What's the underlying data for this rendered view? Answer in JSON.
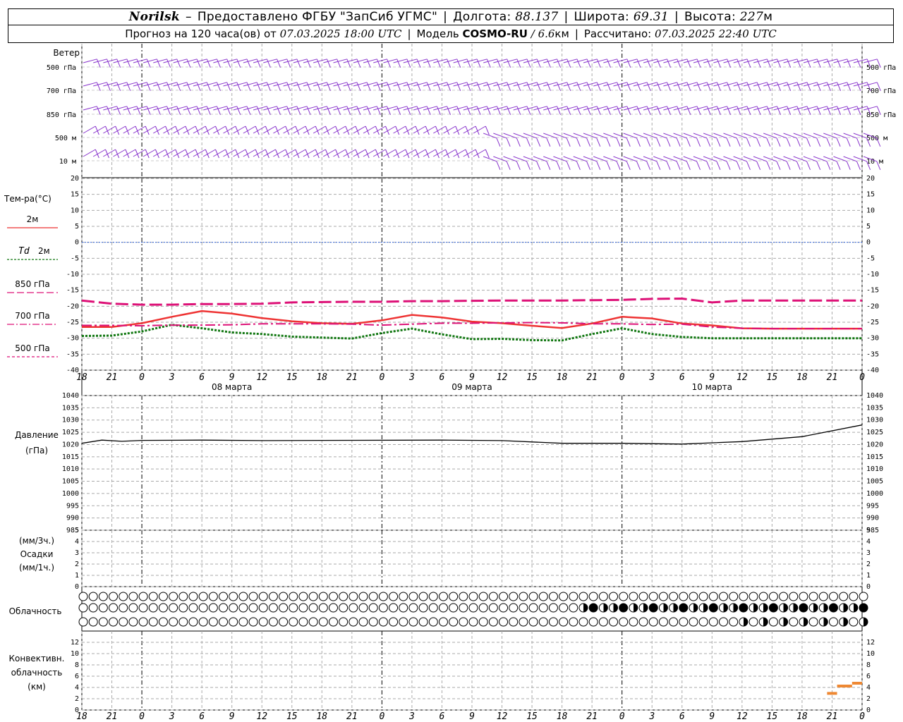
{
  "header": {
    "station": "Norilsk",
    "dash": "–",
    "provider": "Предоставлено ФГБУ \"ЗапСиб УГМС\"",
    "lon_label": "Долгота:",
    "lon_value": "88.137",
    "lat_label": "Широта:",
    "lat_value": "69.31",
    "alt_label": "Высота:",
    "alt_value": "227",
    "alt_unit": "м",
    "forecast_label": "Прогноз на 120 часа(ов) от",
    "forecast_time": "07.03.2025 18:00 UTC",
    "model_label": "Модель",
    "model_name": "COSMO-RU",
    "model_res_sep": "/",
    "model_res": "6.6",
    "model_res_unit": "км",
    "calc_label": "Рассчитано:",
    "calc_time": "07.03.2025 22:40 UTC"
  },
  "colors": {
    "t2m": "#ee3333",
    "td2m": "#117711",
    "t850": "#dd1177",
    "t700": "#dd1177",
    "t500": "#dd1177",
    "wind": "#8833cc",
    "zero": "#3366dd",
    "conv": "#ee8833",
    "pressure": "#000000"
  },
  "chart_data": [
    {
      "type": "wind_barbs",
      "label": "Ветер",
      "levels": [
        "500 гПа",
        "700 гПа",
        "850 гПа",
        "500 м",
        "10 м"
      ]
    },
    {
      "type": "line",
      "label": "Тем-ра(°C)",
      "ylim": [
        -40,
        20
      ],
      "yticks": [
        20,
        15,
        10,
        5,
        0,
        -5,
        -10,
        -15,
        -20,
        -25,
        -30,
        -35,
        -40
      ],
      "x_hours": [
        0,
        3,
        6,
        9,
        12,
        15,
        18,
        21,
        24,
        27,
        30,
        33,
        36,
        39,
        42,
        45,
        48,
        51,
        54,
        57,
        60,
        63,
        66,
        69,
        72,
        75,
        78
      ],
      "series": [
        {
          "name": "2м",
          "style": "solid",
          "values": [
            -26.5,
            -26.5,
            -25.3,
            -23.3,
            -21.5,
            -22.3,
            -23.7,
            -24.7,
            -25.3,
            -25.5,
            -24.4,
            -22.7,
            -23.5,
            -24.8,
            -25.3,
            -26.1,
            -26.8,
            -25.4,
            -23.3,
            -23.8,
            -25.4,
            -26.0,
            -26.9,
            -27.0,
            -27.0,
            -27.0,
            -27.0
          ]
        },
        {
          "name": "Td 2м",
          "name_prefix": "Td",
          "name_suffix": "2м",
          "style": "dotted",
          "values": [
            -29.3,
            -29.2,
            -27.9,
            -25.8,
            -26.9,
            -28.2,
            -28.7,
            -29.5,
            -29.8,
            -30.1,
            -28.4,
            -27.0,
            -28.8,
            -30.3,
            -30.2,
            -30.6,
            -30.7,
            -28.7,
            -26.9,
            -28.7,
            -29.6,
            -30.0,
            -30.0,
            -30.0,
            -30.0,
            -30.0,
            -30.0
          ]
        },
        {
          "name": "850 гПа",
          "style": "longdash",
          "values": [
            -18.2,
            -19.2,
            -19.5,
            -19.5,
            -19.3,
            -19.3,
            -19.2,
            -18.8,
            -18.7,
            -18.6,
            -18.6,
            -18.4,
            -18.4,
            -18.3,
            -18.2,
            -18.2,
            -18.2,
            -18.1,
            -18.0,
            -17.7,
            -17.6,
            -18.8,
            -18.2,
            -18.2,
            -18.2,
            -18.2,
            -18.2
          ]
        },
        {
          "name": "700 гПа",
          "style": "dashdot",
          "values": [
            -26.0,
            -26.0,
            -26.1,
            -25.9,
            -25.9,
            -25.8,
            -25.5,
            -25.5,
            -25.5,
            -25.6,
            -25.9,
            -25.6,
            -25.3,
            -25.3,
            -25.2,
            -25.1,
            -25.2,
            -25.5,
            -25.5,
            -25.7,
            -25.6,
            -26.5,
            -26.9,
            -27.0,
            -27.0,
            -27.0,
            -27.0
          ]
        },
        {
          "name": "500 гПа",
          "style": "shortdash",
          "values": []
        }
      ]
    },
    {
      "type": "line",
      "label": "Давление",
      "unit": "(гПа)",
      "ylim": [
        985,
        1040
      ],
      "yticks": [
        1040,
        1035,
        1030,
        1025,
        1020,
        1015,
        1010,
        1005,
        1000,
        995,
        990,
        985
      ],
      "x_hours": [
        0,
        2,
        4,
        6,
        12,
        18,
        24,
        36,
        42,
        48,
        54,
        60,
        66,
        72,
        78
      ],
      "series": [
        {
          "name": "pressure",
          "values": [
            1020.5,
            1021.8,
            1021.3,
            1021.7,
            1021.8,
            1021.6,
            1021.7,
            1021.8,
            1021.6,
            1020.5,
            1020.5,
            1020.2,
            1021.2,
            1023.2,
            1028.0
          ]
        }
      ]
    },
    {
      "type": "bar",
      "label_top": "(мм/3ч.)",
      "label": "Осадки",
      "label_bottom": "(мм/1ч.)",
      "ylim": [
        0,
        5
      ],
      "yticks": [
        5,
        4,
        3,
        2,
        1,
        0
      ],
      "values": []
    },
    {
      "type": "cloud_symbols",
      "label": "Облачность"
    },
    {
      "type": "bar",
      "label_l1": "Конвективн.",
      "label_l2": "облачность",
      "label_l3": "(км)",
      "ylim": [
        0,
        14
      ],
      "yticks": [
        12,
        10,
        8,
        6,
        4,
        2,
        0
      ],
      "segments": [
        {
          "x0": 74.5,
          "x1": 75.5,
          "bottom": 2.7,
          "top": 3.2
        },
        {
          "x0": 75.5,
          "x1": 77.0,
          "bottom": 4.0,
          "top": 4.5
        },
        {
          "x0": 77.0,
          "x1": 78.0,
          "bottom": 4.5,
          "top": 5.0
        }
      ]
    }
  ],
  "time_axis": {
    "hour_labels": [
      "18",
      "21",
      "0",
      "3",
      "6",
      "9",
      "12",
      "15",
      "18",
      "21",
      "0",
      "3",
      "6",
      "9",
      "12",
      "15",
      "18",
      "21",
      "0",
      "3",
      "6",
      "9",
      "12",
      "15",
      "18",
      "21",
      "0"
    ],
    "day_labels": [
      "08 марта",
      "09 марта",
      "10 марта"
    ]
  }
}
